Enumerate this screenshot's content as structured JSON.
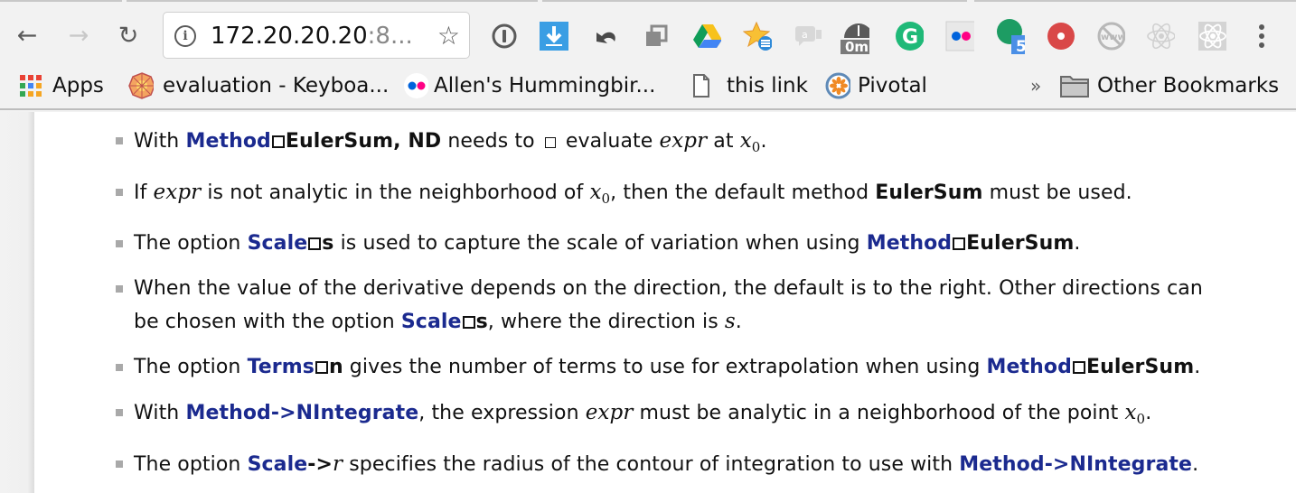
{
  "browser": {
    "url_host": "172.20.20.20",
    "url_rest": ":8...",
    "nav": {
      "back_icon": "arrow-left",
      "forward_icon": "arrow-right",
      "reload_icon": "reload"
    },
    "extensions": [
      {
        "name": "1password-icon",
        "glyph": "①"
      },
      {
        "name": "download-icon",
        "glyph": "⬇"
      },
      {
        "name": "undo-icon",
        "glyph": "↶"
      },
      {
        "name": "tabs-icon",
        "glyph": "❐"
      },
      {
        "name": "google-drive-icon",
        "glyph": "▲"
      },
      {
        "name": "star-list-icon",
        "glyph": "★"
      },
      {
        "name": "chat-icon",
        "glyph": "a"
      },
      {
        "name": "timer-icon",
        "glyph": "◐",
        "badge": "0m"
      },
      {
        "name": "grammarly-icon",
        "glyph": "G"
      },
      {
        "name": "flickr-icon",
        "glyph": "●●"
      },
      {
        "name": "green-dot-icon",
        "glyph": "●",
        "badge": "5"
      },
      {
        "name": "record-icon",
        "glyph": "●"
      },
      {
        "name": "no-www-icon",
        "glyph": "www"
      },
      {
        "name": "react-devtools-disabled-icon",
        "glyph": "⚛"
      },
      {
        "name": "react-devtools-icon",
        "glyph": "⚛"
      },
      {
        "name": "menu-icon",
        "glyph": "⋮"
      }
    ]
  },
  "bookmarks": {
    "items": [
      {
        "label": "Apps",
        "icon": "apps-grid-icon"
      },
      {
        "label": "evaluation - Keyboa...",
        "icon": "mandala-icon"
      },
      {
        "label": "Allen's Hummingbir...",
        "icon": "flickr-icon"
      },
      {
        "label": "this link",
        "icon": "page-icon"
      },
      {
        "label": "Pivotal",
        "icon": "pivotal-icon"
      }
    ],
    "overflow": "»",
    "other": "Other Bookmarks"
  },
  "doc": {
    "items": [
      {
        "parts": [
          "With ",
          "Method",
          "EulerSum",
          ", ",
          "ND",
          " needs to ",
          " evaluate ",
          "expr",
          " at ",
          "x",
          "0",
          "."
        ]
      },
      {
        "parts": [
          "If ",
          "expr",
          " is not analytic in the neighborhood of ",
          "x",
          "0",
          ", then the default method ",
          "EulerSum",
          " must be used."
        ]
      },
      {
        "parts": [
          "The option ",
          "Scale",
          "s",
          " is used to capture the scale of variation when using ",
          "Method",
          "EulerSum",
          "."
        ]
      },
      {
        "parts": [
          "When the value of the derivative depends on the direction, the default is to the right. Other directions can be chosen with the option ",
          "Scale",
          "s",
          ", where the direction is ",
          "s",
          "."
        ]
      },
      {
        "parts": [
          "The option ",
          "Terms",
          "n",
          " gives the number of terms to use for extrapolation when using ",
          "Method",
          "EulerSum",
          "."
        ]
      },
      {
        "parts": [
          "With ",
          "Method->NIntegrate",
          ", the expression ",
          "expr",
          " must be analytic in a neighborhood of the point ",
          "x",
          "0",
          "."
        ]
      },
      {
        "parts": [
          "The option ",
          "Scale",
          "->",
          "r",
          " specifies the radius of the contour of integration to use with ",
          "Method->NIntegrate",
          "."
        ]
      }
    ]
  }
}
